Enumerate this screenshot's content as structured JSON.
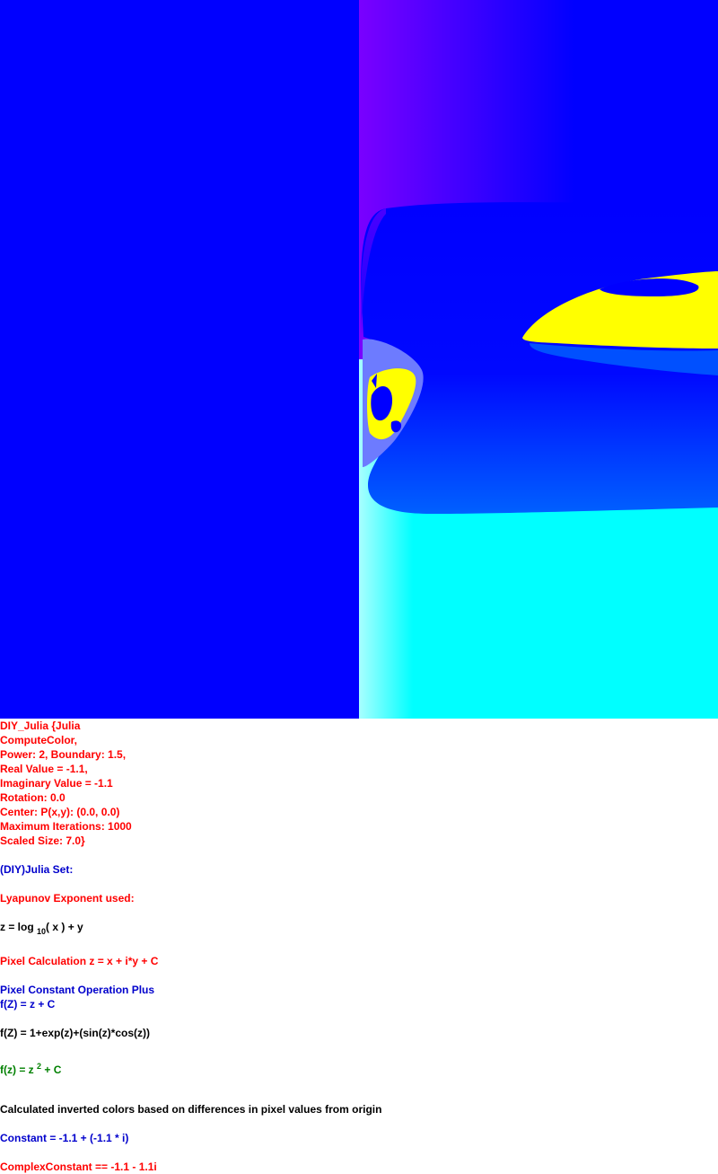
{
  "params": [
    "DIY_Julia {Julia",
    "ComputeColor,",
    "Power: 2, Boundary: 1.5,",
    "Real Value = -1.1,",
    "Imaginary Value = -1.1",
    "Rotation: 0.0",
    "Center: P(x,y): (0.0, 0.0)",
    "Maximum Iterations: 1000",
    "Scaled Size: 7.0}"
  ],
  "set_title": "(DIY)Julia Set:",
  "lyapunov": "Lyapunov Exponent used:",
  "formula_log": {
    "pre": "z = log ",
    "sub": "10",
    "post": "( x ) + y"
  },
  "pixel_calc": "Pixel Calculation z = x + i*y + C",
  "pixel_op": "Pixel Constant Operation Plus",
  "pixel_op_formula": "f(Z) = z + C",
  "function_formula": "f(Z) = 1+exp(z)+(sin(z)*cos(z))",
  "power_formula": {
    "pre": "f(z) = z ",
    "sup": "2",
    "post": " + C"
  },
  "inverted_note": "Calculated inverted colors based on differences in pixel values from origin",
  "constant": "Constant = -1.1 + (-1.1 * i)",
  "complex_constant": "ComplexConstant == -1.1 - 1.1i",
  "colors": {
    "background_blue": "#0000ff",
    "yellow": "#ffff00",
    "cyan": "#00ffff",
    "violet": "#7700ff",
    "red_text": "#ff0000",
    "blue_text": "#0000cc",
    "green_text": "#008000"
  }
}
